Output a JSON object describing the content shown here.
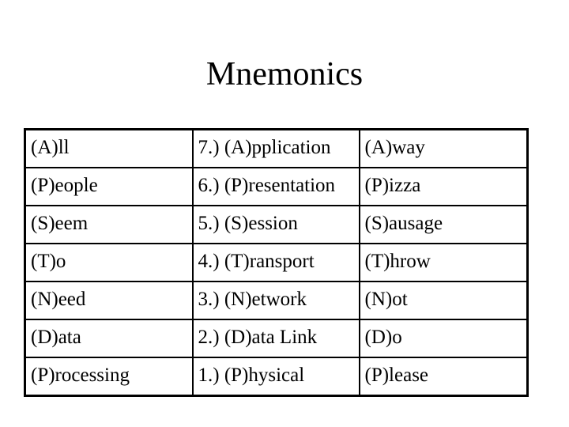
{
  "title": "Mnemonics",
  "table": {
    "rows": [
      [
        "(A)ll",
        "7.) (A)pplication",
        "(A)way"
      ],
      [
        "(P)eople",
        "6.) (P)resentation",
        "(P)izza"
      ],
      [
        "(S)eem",
        "5.) (S)ession",
        "(S)ausage"
      ],
      [
        "(T)o",
        "4.) (T)ransport",
        "(T)hrow"
      ],
      [
        "(N)eed",
        "3.) (N)etwork",
        "(N)ot"
      ],
      [
        "(D)ata",
        "2.) (D)ata Link",
        "(D)o"
      ],
      [
        "(P)rocessing",
        "1.) (P)hysical",
        "(P)lease"
      ]
    ]
  }
}
